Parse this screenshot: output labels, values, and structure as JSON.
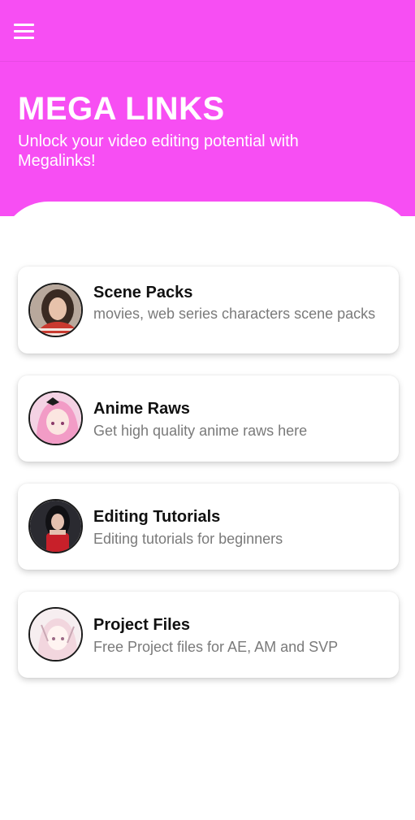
{
  "appbar": {
    "menu_icon": "hamburger-menu-icon"
  },
  "hero": {
    "title": "MEGA LINKS",
    "subtitle": "Unlock your video editing potential with Megalinks!",
    "background": "#f74ef3"
  },
  "cards": [
    {
      "title": "Scene Packs",
      "description": "movies, web series characters scene packs",
      "avatar": "woman-portrait-avatar"
    },
    {
      "title": "Anime Raws",
      "description": "Get high quality anime raws here",
      "avatar": "anime-girl-pink-avatar"
    },
    {
      "title": "Editing Tutorials",
      "description": "Editing tutorials for beginners",
      "avatar": "woman-red-dress-avatar"
    },
    {
      "title": "Project Files",
      "description": "Free Project files for AE, AM and SVP",
      "avatar": "anime-girl-sketch-avatar"
    }
  ]
}
